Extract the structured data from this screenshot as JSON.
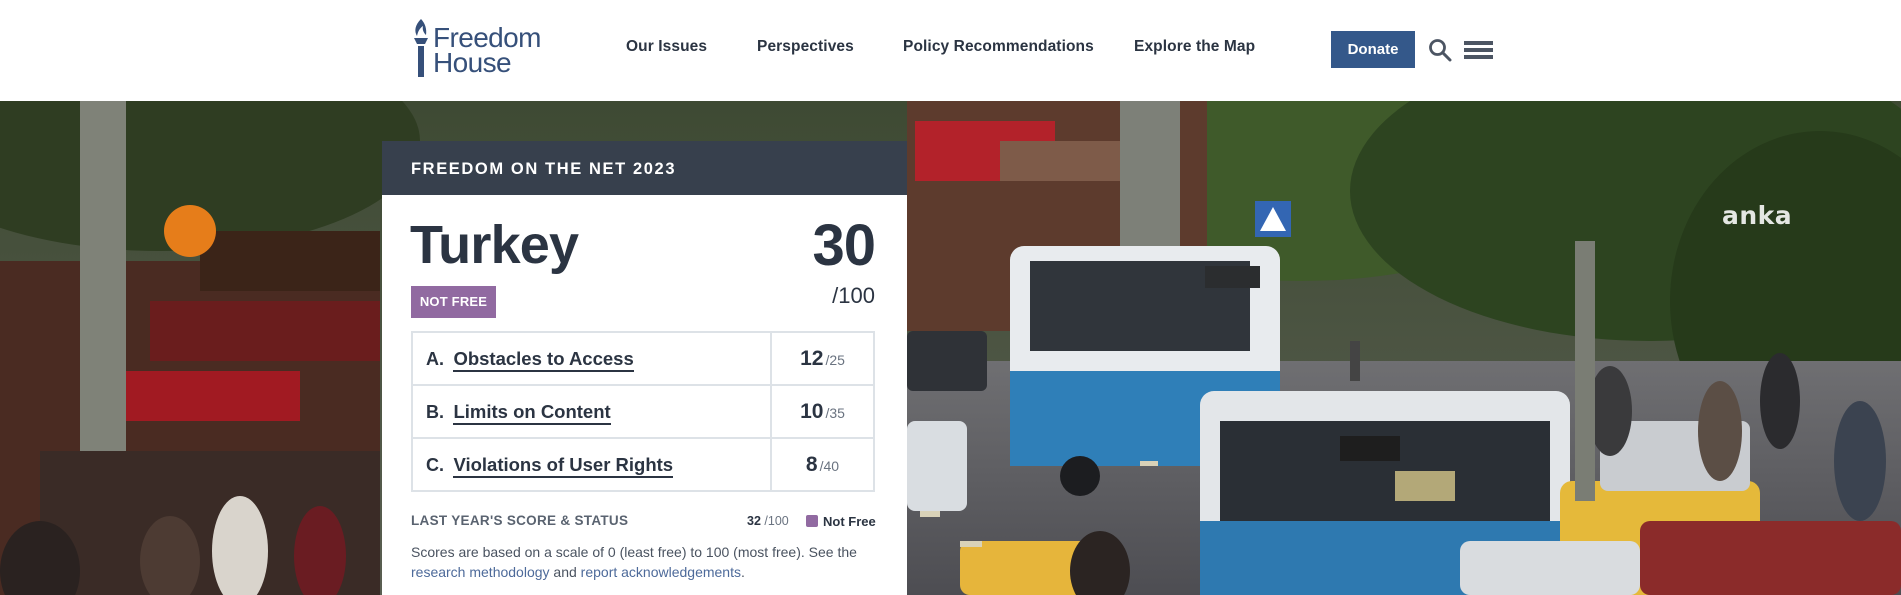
{
  "header": {
    "logo": {
      "line1": "Freedom",
      "line2": "House"
    },
    "nav": [
      "Our Issues",
      "Perspectives",
      "Policy Recommendations",
      "Explore the Map"
    ],
    "donate_label": "Donate",
    "search_icon": "search-icon",
    "menu_icon": "hamburger-menu-icon",
    "colors": {
      "brand": "#36507a",
      "donate": "#34588a"
    }
  },
  "hero": {
    "watermark": "anka"
  },
  "score_card": {
    "report_title": "FREEDOM ON THE NET 2023",
    "country": "Turkey",
    "status": "NOT FREE",
    "status_color": "#916aa1",
    "total_score": "30",
    "total_max": "/100",
    "categories": [
      {
        "letter": "A.",
        "name": "Obstacles to Access",
        "score": "12",
        "max": "/25"
      },
      {
        "letter": "B.",
        "name": "Limits on Content",
        "score": "10",
        "max": "/35"
      },
      {
        "letter": "C.",
        "name": "Violations of User Rights",
        "score": "8",
        "max": "/40"
      }
    ],
    "last_year": {
      "label": "LAST YEAR'S SCORE & STATUS",
      "score": "32",
      "max": "/100",
      "status": "Not Free"
    },
    "note": {
      "text1": "Scores are based on a scale of 0 (least free) to 100 (most free). See the",
      "link1": "research methodology",
      "text2": "and",
      "link2": "report acknowledgements",
      "text3": "."
    }
  }
}
